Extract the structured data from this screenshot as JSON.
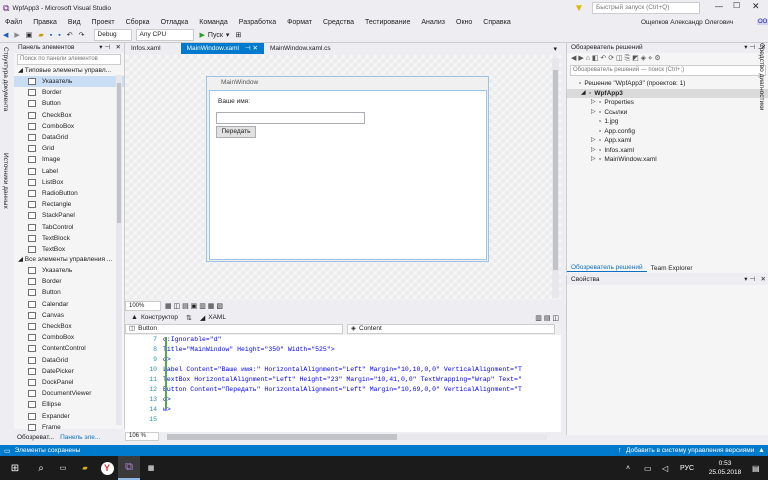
{
  "window": {
    "title": "WpfApp3 - Microsoft Visual Studio",
    "quick_launch_placeholder": "Быстрый запуск (Ctrl+Q)",
    "user": "Ощепков Александр Олегович",
    "user_initials": "OO"
  },
  "menu": [
    "Файл",
    "Правка",
    "Вид",
    "Проект",
    "Сборка",
    "Отладка",
    "Команда",
    "Разработка",
    "Формат",
    "Средства",
    "Тестирование",
    "Анализ",
    "Окно",
    "Справка"
  ],
  "toolbar": {
    "config": "Debug",
    "platform": "Any CPU",
    "run": "Пуск"
  },
  "left_strip": [
    "Структура документа",
    "Источники данных"
  ],
  "toolbox": {
    "title": "Панель элементов",
    "search_placeholder": "Поиск по панели элементов",
    "group1": "◢ Типовые элементы управл...",
    "items1": [
      "Указатель",
      "Border",
      "Button",
      "CheckBox",
      "ComboBox",
      "DataGrid",
      "Grid",
      "Image",
      "Label",
      "ListBox",
      "RadioButton",
      "Rectangle",
      "StackPanel",
      "TabControl",
      "TextBlock",
      "TextBox"
    ],
    "group2": "◢ Все элементы управления ...",
    "items2": [
      "Указатель",
      "Border",
      "Button",
      "Calendar",
      "Canvas",
      "CheckBox",
      "ComboBox",
      "ContentControl",
      "DataGrid",
      "DatePicker",
      "DockPanel",
      "DocumentViewer",
      "Ellipse",
      "Expander",
      "Frame"
    ]
  },
  "tabs": [
    "Infos.xaml",
    "MainWindow.xaml",
    "MainWindow.xaml.cs"
  ],
  "designer": {
    "window_title": "MainWindow",
    "label": "Ваше имя:",
    "textbox_value": "",
    "button": "Передать",
    "zoom": "100%"
  },
  "split": {
    "design": "Конструктор",
    "xaml": "XAML"
  },
  "context": {
    "left": "Button",
    "right": "Content"
  },
  "code": [
    {
      "n": "7",
      "t": "c:Ignorable=\"d\""
    },
    {
      "n": "8",
      "t": "Title=\"MainWindow\" Height=\"350\" Width=\"525\">"
    },
    {
      "n": "9",
      "t": "d>"
    },
    {
      "n": "10",
      "t": "Label Content=\"Ваше имя:\" HorizontalAlignment=\"Left\" Margin=\"10,10,0,0\" VerticalAlignment=\"T"
    },
    {
      "n": "11",
      "t": "TextBox HorizontalAlignment=\"Left\" Height=\"23\" Margin=\"10,41,0,0\" TextWrapping=\"Wrap\" Text=\""
    },
    {
      "n": "12",
      "t": "Button Content=\"Передать\" HorizontalAlignment=\"Left\" Margin=\"10,69,0,0\" VerticalAlignment=\"T"
    },
    {
      "n": "13",
      "t": "d>"
    },
    {
      "n": "14",
      "t": "w>"
    },
    {
      "n": "15",
      "t": ""
    }
  ],
  "code_zoom": "106 %",
  "solution": {
    "title": "Обозреватель решений",
    "search_placeholder": "Обозреватель решений — поиск (Ctrl+;)",
    "nodes": [
      {
        "label": "Решение \"WpfApp3\" (проектов: 1)",
        "indent": 0
      },
      {
        "label": "WpfApp3",
        "indent": 1,
        "bold": true
      },
      {
        "label": "Properties",
        "indent": 2
      },
      {
        "label": "Ссылки",
        "indent": 2
      },
      {
        "label": "1.jpg",
        "indent": 2
      },
      {
        "label": "App.config",
        "indent": 2
      },
      {
        "label": "App.xaml",
        "indent": 2
      },
      {
        "label": "Infos.xaml",
        "indent": 2
      },
      {
        "label": "MainWindow.xaml",
        "indent": 2
      }
    ],
    "tab1": "Обозреватель решений",
    "tab2": "Team Explorer"
  },
  "properties": {
    "title": "Свойства"
  },
  "right_strip": "Средство диагностики",
  "bottom_tabs": [
    "Обозреват...",
    "Панель эле..."
  ],
  "status": {
    "left": "Элементы сохранены",
    "right": "Добавить в систему управления версиями"
  },
  "taskbar": {
    "lang": "РУС",
    "time": "0:53",
    "date": "25.05.2018"
  }
}
